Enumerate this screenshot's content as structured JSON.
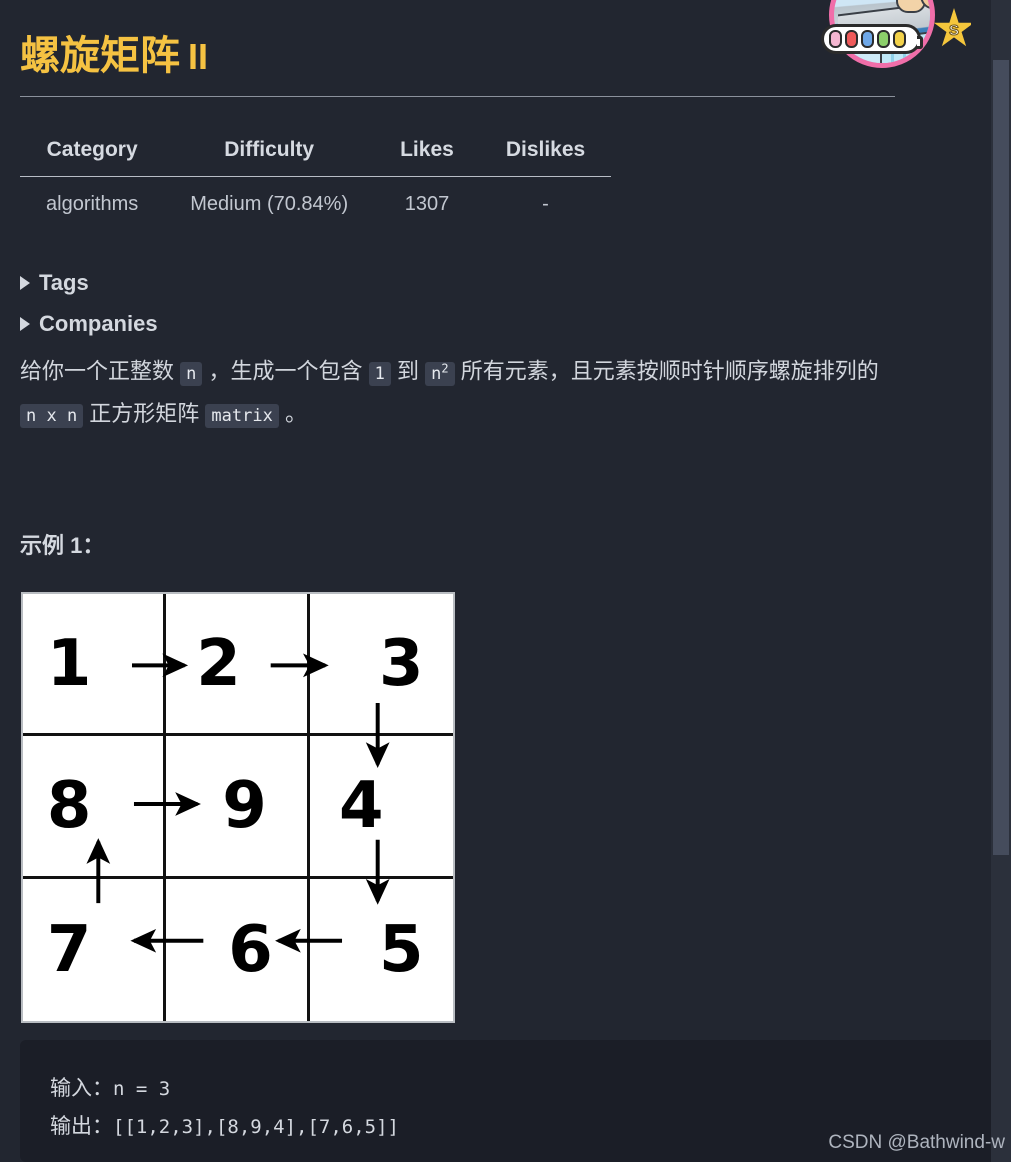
{
  "page": {
    "title_cn": "螺旋矩阵",
    "title_numeral": "II",
    "background_color": "#222630",
    "title_color": "#f5c242"
  },
  "avatar": {
    "star_label": "S",
    "pill_colors": [
      "#f4b6d0",
      "#ef5a5a",
      "#6fa8e8",
      "#8ccf6a",
      "#f3d24a"
    ],
    "ring_color": "#f06ea9",
    "star_color": "#f5c63c"
  },
  "meta_table": {
    "headers": [
      "Category",
      "Difficulty",
      "Likes",
      "Dislikes"
    ],
    "rows": [
      {
        "category": "algorithms",
        "difficulty": "Medium (70.84%)",
        "likes": "1307",
        "dislikes": "-"
      }
    ]
  },
  "sections": {
    "tags_label": "Tags",
    "companies_label": "Companies",
    "marker_icon": "triangle-right-icon"
  },
  "description": {
    "part1": "给你一个正整数 ",
    "code_n": "n",
    "part2": " ，生成一个包含 ",
    "code_1": "1",
    "part3": " 到 ",
    "code_n2_base": "n",
    "code_n2_exp": "2",
    "part4": " 所有元素，且元素按顺时针顺序螺旋排列的 ",
    "code_nxn": "n x n",
    "part5": " 正方形矩阵 ",
    "code_matrix": "matrix",
    "part6": " 。"
  },
  "example": {
    "heading": "示例 1：",
    "figure_alt": "3x3 spiral matrix diagram",
    "matrix": [
      [
        "1",
        "2",
        "3"
      ],
      [
        "8",
        "9",
        "4"
      ],
      [
        "7",
        "6",
        "5"
      ]
    ],
    "code_input_label": "输入：",
    "code_input_value": "n = 3",
    "code_output_label": "输出：",
    "code_output_value": "[[1,2,3],[8,9,4],[7,6,5]]"
  },
  "watermark": {
    "text": "CSDN @Bathwind-w"
  },
  "scrollbar": {
    "track_color": "#2b303b",
    "thumb_color": "#454c5c"
  }
}
